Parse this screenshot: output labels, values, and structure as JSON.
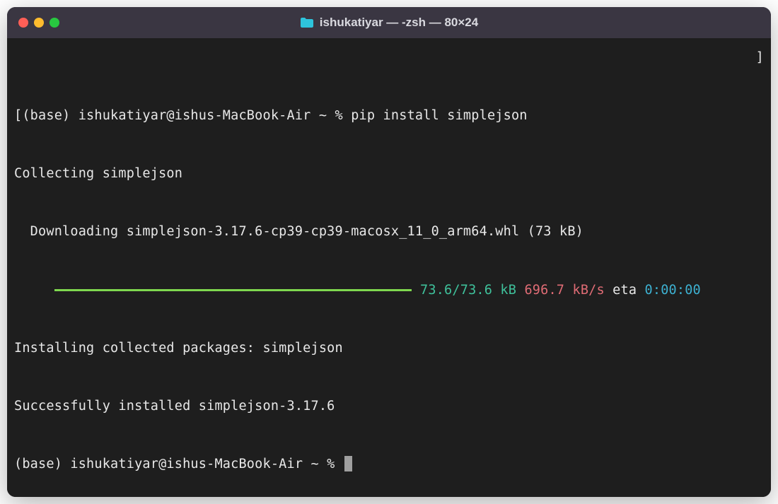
{
  "window": {
    "title": "ishukatiyar — -zsh — 80×24"
  },
  "terminal": {
    "prompt_left": "[(base) ishukatiyar@ishus-MacBook-Air ~ % ",
    "command": "pip install simplejson",
    "right_bracket": "]",
    "collecting": "Collecting simplejson",
    "downloading": "  Downloading simplejson-3.17.6-cp39-cp39-macosx_11_0_arm64.whl (73 kB)",
    "progress_indent": "     ",
    "progress_done": " 73.6/73.6 kB",
    "progress_rate": " 696.7 kB/s",
    "progress_eta_label": " eta",
    "progress_eta": " 0:00:00",
    "installing": "Installing collected packages: simplejson",
    "success": "Successfully installed simplejson-3.17.6",
    "prompt2": "(base) ishukatiyar@ishus-MacBook-Air ~ % "
  }
}
